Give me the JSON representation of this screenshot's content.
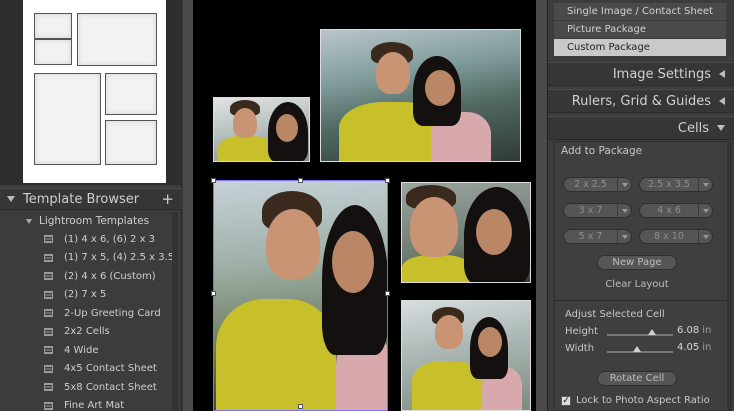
{
  "left_panel": {
    "template_browser": {
      "title": "Template Browser",
      "add_label": "+",
      "folder": "Lightroom Templates",
      "items": [
        "(1) 4 x 6, (6) 2 x 3",
        "(1) 7 x 5, (4) 2.5 x 3.5",
        "(2) 4 x 6 (Custom)",
        "(2) 7 x 5",
        "2-Up Greeting Card",
        "2x2 Cells",
        "4 Wide",
        "4x5 Contact Sheet",
        "5x8 Contact Sheet",
        "Fine Art Mat"
      ]
    }
  },
  "right_panel": {
    "layout_style": {
      "options": [
        "Single Image / Contact Sheet",
        "Picture Package",
        "Custom Package"
      ],
      "selected": "Custom Package"
    },
    "sections": {
      "image_settings": "Image Settings",
      "rulers": "Rulers, Grid & Guides",
      "cells": "Cells"
    },
    "cells": {
      "add_to_package": "Add to Package",
      "sizes": [
        "2 x 2.5",
        "2.5 x 3.5",
        "3 x 7",
        "4 x 6",
        "5 x 7",
        "8 x 10"
      ],
      "new_page": "New Page",
      "clear_layout": "Clear Layout",
      "adjust_selected": "Adjust Selected Cell",
      "height_label": "Height",
      "height_value": "6.08",
      "width_label": "Width",
      "width_value": "4.05",
      "unit": "in",
      "height_fraction": 0.68,
      "width_fraction": 0.45,
      "rotate_cell": "Rotate Cell",
      "lock_label": "Lock to Photo Aspect Ratio",
      "lock_checked": true,
      "check_glyph": "✓"
    }
  },
  "colors": {
    "selection": "#7a6cff",
    "active_option": "#c9c9c9",
    "shirt": "#c8c02a"
  }
}
